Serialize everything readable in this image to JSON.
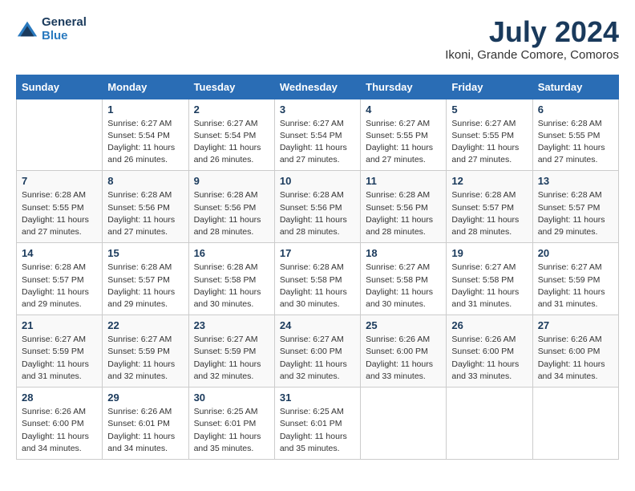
{
  "header": {
    "logo_general": "General",
    "logo_blue": "Blue",
    "month_year": "July 2024",
    "location": "Ikoni, Grande Comore, Comoros"
  },
  "days_of_week": [
    "Sunday",
    "Monday",
    "Tuesday",
    "Wednesday",
    "Thursday",
    "Friday",
    "Saturday"
  ],
  "weeks": [
    [
      {
        "day": "",
        "info": ""
      },
      {
        "day": "1",
        "info": "Sunrise: 6:27 AM\nSunset: 5:54 PM\nDaylight: 11 hours\nand 26 minutes."
      },
      {
        "day": "2",
        "info": "Sunrise: 6:27 AM\nSunset: 5:54 PM\nDaylight: 11 hours\nand 26 minutes."
      },
      {
        "day": "3",
        "info": "Sunrise: 6:27 AM\nSunset: 5:54 PM\nDaylight: 11 hours\nand 27 minutes."
      },
      {
        "day": "4",
        "info": "Sunrise: 6:27 AM\nSunset: 5:55 PM\nDaylight: 11 hours\nand 27 minutes."
      },
      {
        "day": "5",
        "info": "Sunrise: 6:27 AM\nSunset: 5:55 PM\nDaylight: 11 hours\nand 27 minutes."
      },
      {
        "day": "6",
        "info": "Sunrise: 6:28 AM\nSunset: 5:55 PM\nDaylight: 11 hours\nand 27 minutes."
      }
    ],
    [
      {
        "day": "7",
        "info": "Sunrise: 6:28 AM\nSunset: 5:55 PM\nDaylight: 11 hours\nand 27 minutes."
      },
      {
        "day": "8",
        "info": "Sunrise: 6:28 AM\nSunset: 5:56 PM\nDaylight: 11 hours\nand 27 minutes."
      },
      {
        "day": "9",
        "info": "Sunrise: 6:28 AM\nSunset: 5:56 PM\nDaylight: 11 hours\nand 28 minutes."
      },
      {
        "day": "10",
        "info": "Sunrise: 6:28 AM\nSunset: 5:56 PM\nDaylight: 11 hours\nand 28 minutes."
      },
      {
        "day": "11",
        "info": "Sunrise: 6:28 AM\nSunset: 5:56 PM\nDaylight: 11 hours\nand 28 minutes."
      },
      {
        "day": "12",
        "info": "Sunrise: 6:28 AM\nSunset: 5:57 PM\nDaylight: 11 hours\nand 28 minutes."
      },
      {
        "day": "13",
        "info": "Sunrise: 6:28 AM\nSunset: 5:57 PM\nDaylight: 11 hours\nand 29 minutes."
      }
    ],
    [
      {
        "day": "14",
        "info": "Sunrise: 6:28 AM\nSunset: 5:57 PM\nDaylight: 11 hours\nand 29 minutes."
      },
      {
        "day": "15",
        "info": "Sunrise: 6:28 AM\nSunset: 5:57 PM\nDaylight: 11 hours\nand 29 minutes."
      },
      {
        "day": "16",
        "info": "Sunrise: 6:28 AM\nSunset: 5:58 PM\nDaylight: 11 hours\nand 30 minutes."
      },
      {
        "day": "17",
        "info": "Sunrise: 6:28 AM\nSunset: 5:58 PM\nDaylight: 11 hours\nand 30 minutes."
      },
      {
        "day": "18",
        "info": "Sunrise: 6:27 AM\nSunset: 5:58 PM\nDaylight: 11 hours\nand 30 minutes."
      },
      {
        "day": "19",
        "info": "Sunrise: 6:27 AM\nSunset: 5:58 PM\nDaylight: 11 hours\nand 31 minutes."
      },
      {
        "day": "20",
        "info": "Sunrise: 6:27 AM\nSunset: 5:59 PM\nDaylight: 11 hours\nand 31 minutes."
      }
    ],
    [
      {
        "day": "21",
        "info": "Sunrise: 6:27 AM\nSunset: 5:59 PM\nDaylight: 11 hours\nand 31 minutes."
      },
      {
        "day": "22",
        "info": "Sunrise: 6:27 AM\nSunset: 5:59 PM\nDaylight: 11 hours\nand 32 minutes."
      },
      {
        "day": "23",
        "info": "Sunrise: 6:27 AM\nSunset: 5:59 PM\nDaylight: 11 hours\nand 32 minutes."
      },
      {
        "day": "24",
        "info": "Sunrise: 6:27 AM\nSunset: 6:00 PM\nDaylight: 11 hours\nand 32 minutes."
      },
      {
        "day": "25",
        "info": "Sunrise: 6:26 AM\nSunset: 6:00 PM\nDaylight: 11 hours\nand 33 minutes."
      },
      {
        "day": "26",
        "info": "Sunrise: 6:26 AM\nSunset: 6:00 PM\nDaylight: 11 hours\nand 33 minutes."
      },
      {
        "day": "27",
        "info": "Sunrise: 6:26 AM\nSunset: 6:00 PM\nDaylight: 11 hours\nand 34 minutes."
      }
    ],
    [
      {
        "day": "28",
        "info": "Sunrise: 6:26 AM\nSunset: 6:00 PM\nDaylight: 11 hours\nand 34 minutes."
      },
      {
        "day": "29",
        "info": "Sunrise: 6:26 AM\nSunset: 6:01 PM\nDaylight: 11 hours\nand 34 minutes."
      },
      {
        "day": "30",
        "info": "Sunrise: 6:25 AM\nSunset: 6:01 PM\nDaylight: 11 hours\nand 35 minutes."
      },
      {
        "day": "31",
        "info": "Sunrise: 6:25 AM\nSunset: 6:01 PM\nDaylight: 11 hours\nand 35 minutes."
      },
      {
        "day": "",
        "info": ""
      },
      {
        "day": "",
        "info": ""
      },
      {
        "day": "",
        "info": ""
      }
    ]
  ]
}
